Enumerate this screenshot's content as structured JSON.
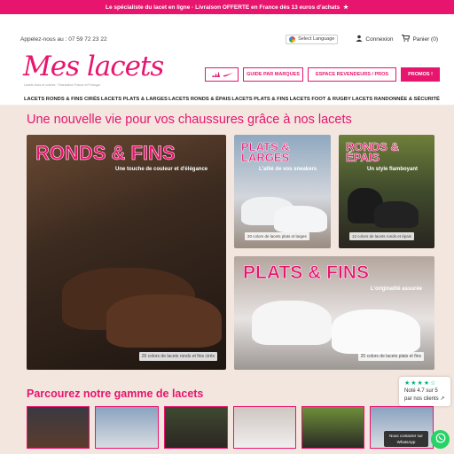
{
  "topbar": {
    "text_1": "Le spécialiste du lacet en ligne",
    "separator": " · ",
    "text_2": "Livraison OFFERTE en France dès 13 euros d'achats",
    "star": "★"
  },
  "header": {
    "phone": "Appelez-nous au : 07 59 72 23 22",
    "language": "Select Language",
    "login": "Connexion",
    "cart": "Panier (0)",
    "logo": "Mes lacets",
    "tagline": "Lacets chics et colorés · Fabrication France et Portugal",
    "buttons": {
      "guide": "GUIDE PAR MARQUES",
      "revendeurs": "ESPACE REVENDEURS / PROS",
      "promos": "PROMOS !"
    }
  },
  "nav": [
    "LACETS RONDS & FINS CIRÉS",
    "LACETS PLATS & LARGES",
    "LACETS RONDS & ÉPAIS",
    "LACETS PLATS & FINS",
    "LACETS FOOT & RUGBY",
    "LACETS RANDONNÉE & SÉCURITÉ"
  ],
  "hero": {
    "title": "Une nouvelle vie pour vos chaussures grâce à nos lacets",
    "tiles": [
      {
        "label": "RONDS & FINS",
        "sub": "Une touche de couleur et d'élégance",
        "caption": "26 colors de lacets ronds et fins cirés"
      },
      {
        "label": "PLATS & LARGES",
        "sub": "L'allié de vos sneakers",
        "caption": "20 colors de lacets plats et larges"
      },
      {
        "label": "RONDS & ÉPAIS",
        "sub": "Un style flamboyant",
        "caption": "12 colors de lacets ronds et épais"
      },
      {
        "label": "PLATS & FINS",
        "sub": "L'originalité assurée",
        "caption": "20 colors de lacets plats et fins"
      }
    ]
  },
  "range": {
    "title": "Parcourez notre gamme de lacets"
  },
  "review": {
    "stars": "★★★★☆",
    "score": "Noté 4.7 sur 5",
    "link": "par nos clients",
    "arrow": "↗"
  },
  "whatsapp": {
    "label": "Nous contacter sur WhatsApp"
  },
  "colors": {
    "brand": "#e8156f",
    "whatsapp": "#25d366",
    "trustpilot": "#00b67a"
  },
  "icons": [
    "google-icon",
    "user-icon",
    "cart-icon",
    "adidas-icon",
    "nike-icon",
    "whatsapp-icon",
    "star-icon"
  ]
}
